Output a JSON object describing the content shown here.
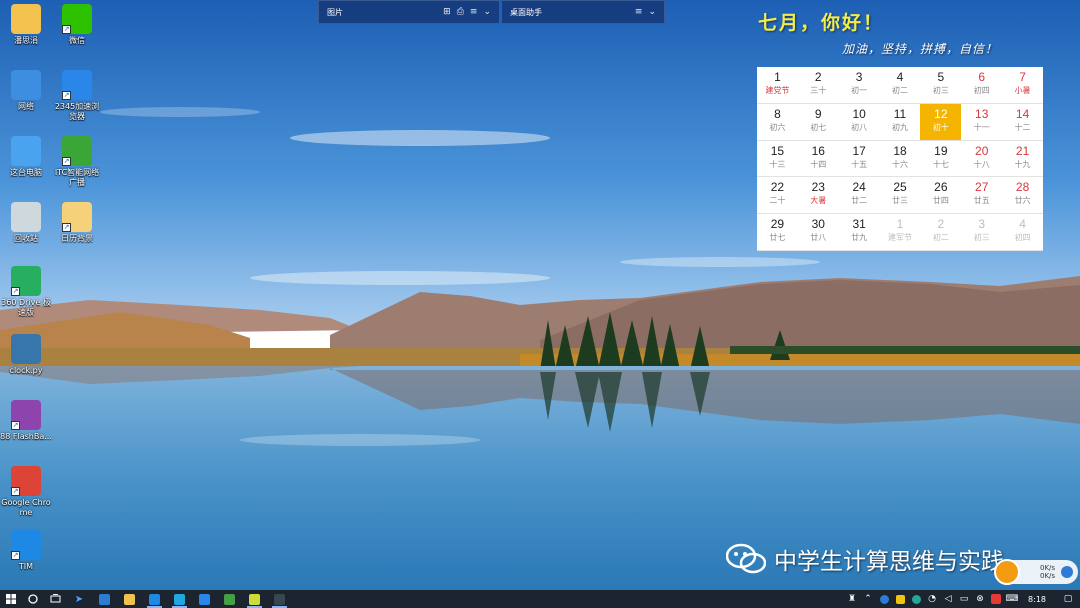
{
  "desktop_icons": [
    {
      "name": "desktop-icon-user-folder",
      "label": "潘思涓",
      "icon": "user-folder-icon",
      "color": "#f2c14e",
      "shortcut": false
    },
    {
      "name": "desktop-icon-wechat",
      "label": "微信",
      "icon": "wechat-icon",
      "color": "#2dc100",
      "shortcut": true
    },
    {
      "name": "desktop-icon-network",
      "label": "网络",
      "icon": "network-icon",
      "color": "#3d8ee0",
      "shortcut": false
    },
    {
      "name": "desktop-icon-2345-browser",
      "label": "2345加速浏览器",
      "icon": "browser-e-icon",
      "color": "#2a86e8",
      "shortcut": true
    },
    {
      "name": "desktop-icon-this-pc",
      "label": "这台电脑",
      "icon": "computer-icon",
      "color": "#4aa3ef",
      "shortcut": false
    },
    {
      "name": "desktop-icon-itc-broadcast",
      "label": "ITC智能网络广播",
      "icon": "green-cube-icon",
      "color": "#3aa637",
      "shortcut": true
    },
    {
      "name": "desktop-icon-recycle-bin",
      "label": "回收站",
      "icon": "recycle-bin-icon",
      "color": "#cfd8dc",
      "shortcut": false
    },
    {
      "name": "desktop-icon-calendar-bg",
      "label": "日历背景",
      "icon": "document-icon",
      "color": "#f5d27a",
      "shortcut": true
    },
    {
      "name": "desktop-icon-sender",
      "label": "360 Drive 极速版",
      "icon": "paper-plane-icon",
      "color": "#27ae60",
      "shortcut": true
    },
    {
      "name": "desktop-icon-clockpy",
      "label": "clock.py",
      "icon": "python-icon",
      "color": "#3776ab",
      "shortcut": false
    },
    {
      "name": "desktop-icon-flash",
      "label": "88 FlashBa...",
      "icon": "gauge-icon",
      "color": "#8e44ad",
      "shortcut": true
    },
    {
      "name": "desktop-icon-chrome",
      "label": "Google Chrome",
      "icon": "chrome-icon",
      "color": "#db4437",
      "shortcut": true
    },
    {
      "name": "desktop-icon-tim",
      "label": "TIM",
      "icon": "tim-star-icon",
      "color": "#1e88e5",
      "shortcut": true
    }
  ],
  "fences": [
    {
      "title": "图片",
      "controls": [
        "⊞",
        "⎙",
        "≡",
        "⌄"
      ]
    },
    {
      "title": "桌面助手",
      "controls": [
        "≡",
        "⌄"
      ]
    }
  ],
  "calendar": {
    "greeting": "七月，你好！",
    "motto": "加油，坚持，拼搏，自信！",
    "days": [
      {
        "d": "1",
        "l": "建党节",
        "weekend": false,
        "holiday": true
      },
      {
        "d": "2",
        "l": "三十",
        "weekend": false
      },
      {
        "d": "3",
        "l": "初一",
        "weekend": false
      },
      {
        "d": "4",
        "l": "初二",
        "weekend": false
      },
      {
        "d": "5",
        "l": "初三",
        "weekend": false
      },
      {
        "d": "6",
        "l": "初四",
        "weekend": true
      },
      {
        "d": "7",
        "l": "小暑",
        "weekend": true,
        "holiday": true
      },
      {
        "d": "8",
        "l": "初六",
        "weekend": false
      },
      {
        "d": "9",
        "l": "初七",
        "weekend": false
      },
      {
        "d": "10",
        "l": "初八",
        "weekend": false
      },
      {
        "d": "11",
        "l": "初九",
        "weekend": false
      },
      {
        "d": "12",
        "l": "初十",
        "weekend": false,
        "today": true
      },
      {
        "d": "13",
        "l": "十一",
        "weekend": true
      },
      {
        "d": "14",
        "l": "十二",
        "weekend": true
      },
      {
        "d": "15",
        "l": "十三",
        "weekend": false
      },
      {
        "d": "16",
        "l": "十四",
        "weekend": false
      },
      {
        "d": "17",
        "l": "十五",
        "weekend": false
      },
      {
        "d": "18",
        "l": "十六",
        "weekend": false
      },
      {
        "d": "19",
        "l": "十七",
        "weekend": false
      },
      {
        "d": "20",
        "l": "十八",
        "weekend": true
      },
      {
        "d": "21",
        "l": "十九",
        "weekend": true
      },
      {
        "d": "22",
        "l": "二十",
        "weekend": false
      },
      {
        "d": "23",
        "l": "大暑",
        "weekend": false,
        "holiday": true
      },
      {
        "d": "24",
        "l": "廿二",
        "weekend": false
      },
      {
        "d": "25",
        "l": "廿三",
        "weekend": false
      },
      {
        "d": "26",
        "l": "廿四",
        "weekend": false
      },
      {
        "d": "27",
        "l": "廿五",
        "weekend": true
      },
      {
        "d": "28",
        "l": "廿六",
        "weekend": true
      },
      {
        "d": "29",
        "l": "廿七",
        "weekend": false
      },
      {
        "d": "30",
        "l": "廿八",
        "weekend": false
      },
      {
        "d": "31",
        "l": "廿九",
        "weekend": false
      },
      {
        "d": "1",
        "l": "建军节",
        "other": true
      },
      {
        "d": "2",
        "l": "初二",
        "other": true
      },
      {
        "d": "3",
        "l": "初三",
        "other": true
      },
      {
        "d": "4",
        "l": "初四",
        "other": true
      }
    ]
  },
  "watermark": {
    "text": "中学生计算思维与实践",
    "icon": "wechat-icon"
  },
  "netspeed": {
    "up": "0K/s",
    "down": "0K/s"
  },
  "taskbar": {
    "start": "windows-start-icon",
    "apps": [
      {
        "name": "taskbar-edge",
        "icon": "edge-icon",
        "color": "#2b7cd3",
        "running": false
      },
      {
        "name": "taskbar-explorer",
        "icon": "folder-icon",
        "color": "#f2c14e",
        "running": false
      },
      {
        "name": "taskbar-app-blue",
        "icon": "circle-app-icon",
        "color": "#1e88e5",
        "running": true
      },
      {
        "name": "taskbar-ie",
        "icon": "ie-icon",
        "color": "#1ea7e1",
        "running": true
      },
      {
        "name": "taskbar-2345",
        "icon": "browser-e-icon",
        "color": "#2a86e8",
        "running": false
      },
      {
        "name": "taskbar-green",
        "icon": "green-app-icon",
        "color": "#43a047",
        "running": false
      },
      {
        "name": "taskbar-notepad",
        "icon": "notepad-icon",
        "color": "#cddc39",
        "running": true
      },
      {
        "name": "taskbar-cmd",
        "icon": "terminal-icon",
        "color": "#37474f",
        "running": true
      }
    ],
    "time": "8:18"
  },
  "colors": {
    "taskbar": "#1c2430",
    "today": "#f5b400",
    "weekend": "#d9363e",
    "greeting": "#f3ec4a"
  }
}
